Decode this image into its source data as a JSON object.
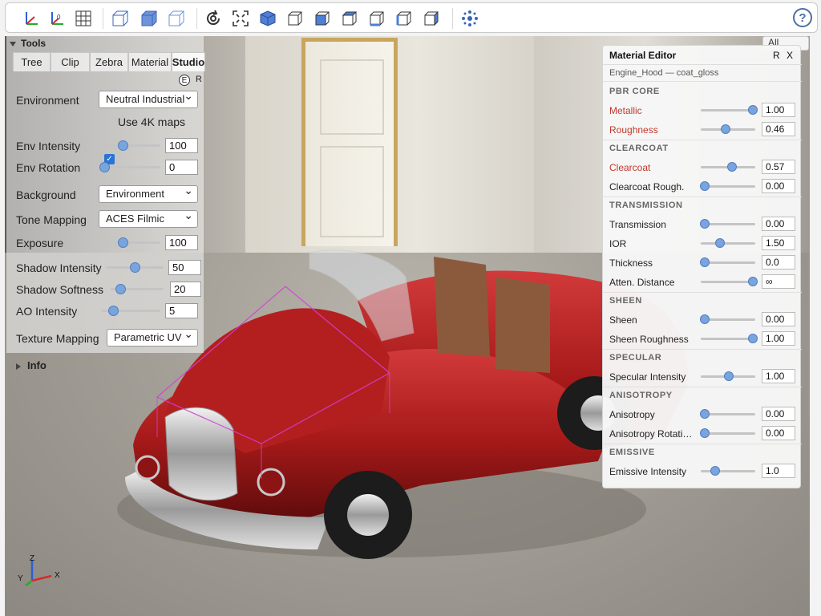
{
  "toolbar": {
    "icons": [
      "axes-icon",
      "axes-alt-icon",
      "grid-icon",
      "box-transparent-icon",
      "box-solid-icon",
      "box-wire-icon",
      "reset-view-icon",
      "fit-view-icon",
      "iso-view-icon",
      "front-view-icon",
      "rear-view-icon",
      "top-view-icon",
      "bottom-view-icon",
      "left-view-icon",
      "right-view-icon",
      "explode-icon",
      "help-icon"
    ],
    "help_label": "?"
  },
  "tools": {
    "title": "Tools",
    "tabs": [
      "Tree",
      "Clip",
      "Zebra",
      "Material",
      "Studio"
    ],
    "active_tab": "Studio",
    "e_label": "E",
    "r_label": "R",
    "environment_label": "Environment",
    "environment_value": "Neutral Industrial",
    "use4k_label": "Use 4K maps",
    "use4k_checked": true,
    "env_intensity_label": "Env Intensity",
    "env_intensity_value": "100",
    "env_rotation_label": "Env Rotation",
    "env_rotation_value": "0",
    "background_label": "Background",
    "background_value": "Environment",
    "tone_mapping_label": "Tone Mapping",
    "tone_mapping_value": "ACES Filmic",
    "exposure_label": "Exposure",
    "exposure_value": "100",
    "shadow_intensity_label": "Shadow Intensity",
    "shadow_intensity_value": "50",
    "shadow_softness_label": "Shadow Softness",
    "shadow_softness_value": "20",
    "ao_intensity_label": "AO Intensity",
    "ao_intensity_value": "5",
    "texture_mapping_label": "Texture Mapping",
    "texture_mapping_value": "Parametric UV",
    "info_label": "Info"
  },
  "all_select": "All",
  "material": {
    "title": "Material Editor",
    "r_label": "R",
    "x_label": "X",
    "subtitle": "Engine_Hood — coat_gloss",
    "sections": {
      "pbr": "PBR CORE",
      "clearcoat": "CLEARCOAT",
      "transmission": "TRANSMISSION",
      "sheen": "SHEEN",
      "specular": "SPECULAR",
      "anisotropy": "ANISOTROPY",
      "emissive": "EMISSIVE"
    },
    "props": {
      "metallic": {
        "label": "Metallic",
        "value": "1.00",
        "level": 1.0
      },
      "roughness": {
        "label": "Roughness",
        "value": "0.46",
        "level": 0.46
      },
      "clearcoat": {
        "label": "Clearcoat",
        "value": "0.57",
        "level": 0.57
      },
      "clearcoat_rough": {
        "label": "Clearcoat Rough.",
        "value": "0.00",
        "level": 0.0
      },
      "transmission": {
        "label": "Transmission",
        "value": "0.00",
        "level": 0.0
      },
      "ior": {
        "label": "IOR",
        "value": "1.50",
        "level": 0.3
      },
      "thickness": {
        "label": "Thickness",
        "value": "0.0",
        "level": 0.0
      },
      "atten_distance": {
        "label": "Atten. Distance",
        "value": "∞",
        "level": 1.0
      },
      "sheen": {
        "label": "Sheen",
        "value": "0.00",
        "level": 0.0
      },
      "sheen_roughness": {
        "label": "Sheen Roughness",
        "value": "1.00",
        "level": 1.0
      },
      "specular_intensity": {
        "label": "Specular Intensity",
        "value": "1.00",
        "level": 0.5
      },
      "anisotropy": {
        "label": "Anisotropy",
        "value": "0.00",
        "level": 0.0
      },
      "anisotropy_rotation": {
        "label": "Anisotropy Rotati…",
        "value": "0.00",
        "level": 0.0
      },
      "emissive_intensity": {
        "label": "Emissive Intensity",
        "value": "1.0",
        "level": 0.18
      }
    }
  },
  "axes": {
    "x": "X",
    "y": "Y",
    "z": "Z"
  },
  "colors": {
    "accent": "#7aa4de",
    "modified": "#c0392b",
    "car_body": "#a81a1a",
    "selection": "#d33fd3"
  }
}
